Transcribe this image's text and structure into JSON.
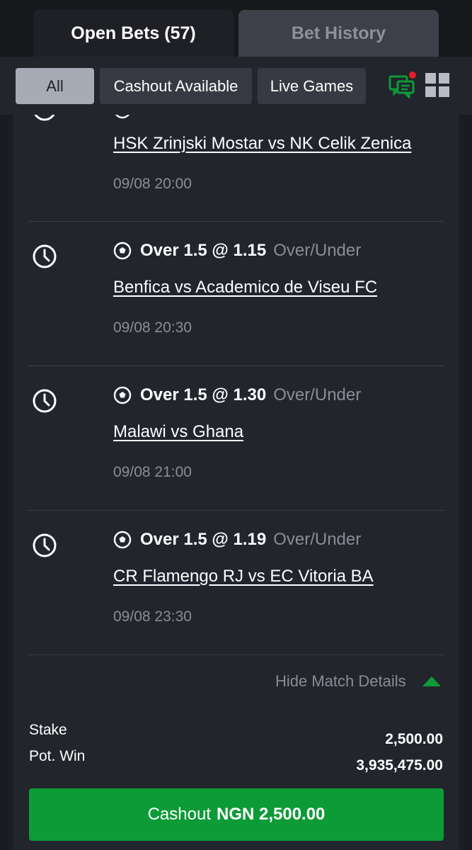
{
  "tabs": {
    "open_bets": "Open Bets (57)",
    "bet_history": "Bet History"
  },
  "filters": {
    "all": "All",
    "cashout_available": "Cashout Available",
    "live_games": "Live Games"
  },
  "icons": {
    "chat": "chat-notification-icon",
    "grid": "grid-view-icon",
    "clock": "clock-icon",
    "ball": "soccer-ball-icon",
    "caret": "caret-up-icon"
  },
  "matches": [
    {
      "selection": "",
      "market": "",
      "teams": "HSK Zrinjski Mostar vs NK Celik Zenica",
      "time": "09/08 20:00"
    },
    {
      "selection": "Over 1.5 @ 1.15",
      "market": "Over/Under",
      "teams": "Benfica vs Academico de Viseu FC",
      "time": "09/08 20:30"
    },
    {
      "selection": "Over 1.5 @ 1.30",
      "market": "Over/Under",
      "teams": "Malawi vs Ghana",
      "time": "09/08 21:00"
    },
    {
      "selection": "Over 1.5 @ 1.19",
      "market": "Over/Under",
      "teams": "CR Flamengo RJ vs EC Vitoria BA",
      "time": "09/08 23:30"
    }
  ],
  "details_toggle": "Hide Match Details",
  "summary": {
    "stake_label": "Stake",
    "stake_value": "2,500.00",
    "potwin_label": "Pot. Win",
    "potwin_value": "3,935,475.00"
  },
  "cashout": {
    "prefix": "Cashout",
    "amount": "NGN 2,500.00"
  },
  "colors": {
    "accent_green": "#0d9b37",
    "notification_red": "#e0202a",
    "background": "#22252c"
  }
}
